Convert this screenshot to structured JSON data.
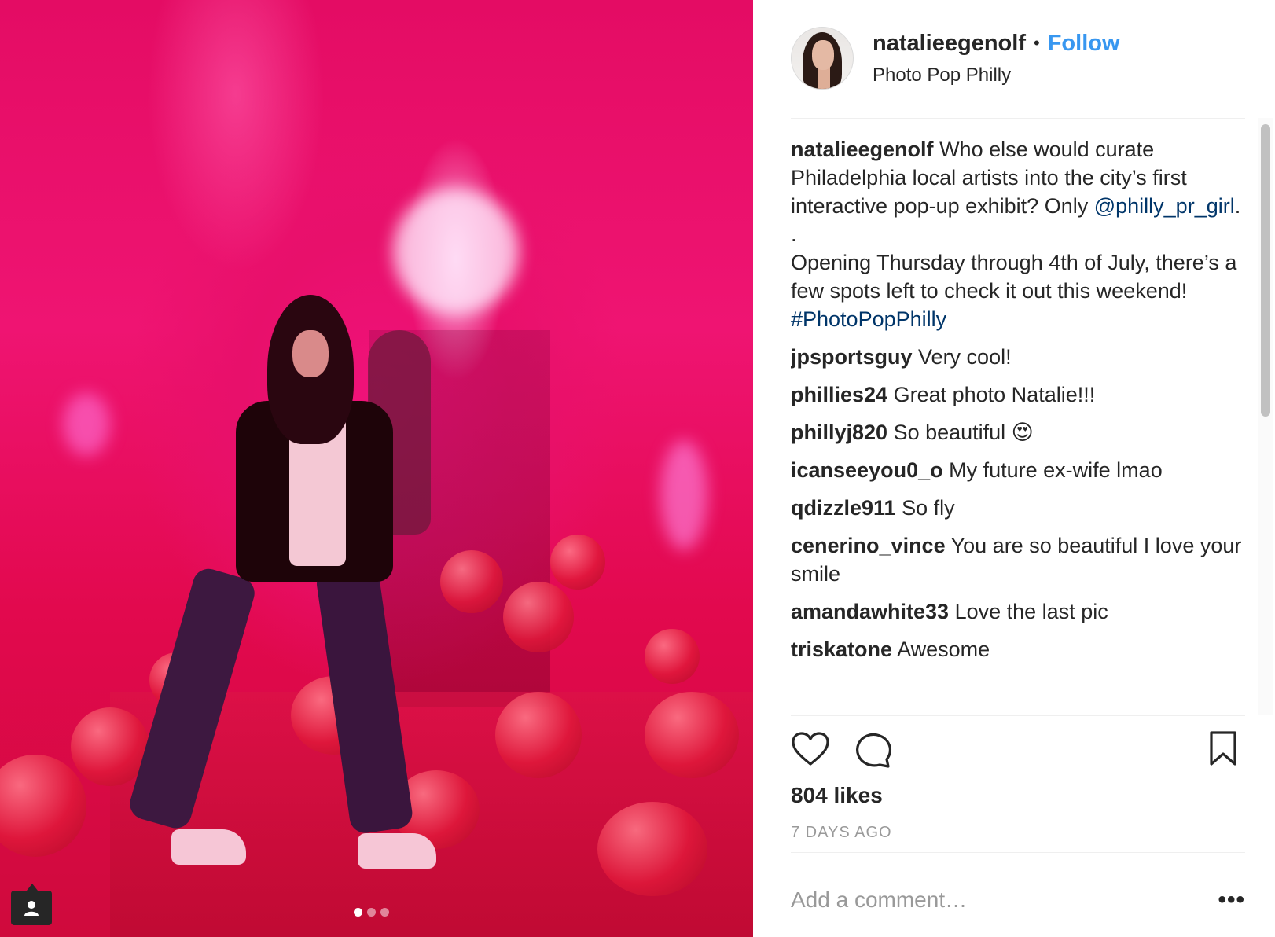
{
  "post": {
    "username": "natalieegenolf",
    "separator": "•",
    "follow_label": "Follow",
    "location": "Photo Pop Philly"
  },
  "caption": {
    "username": "natalieegenolf",
    "text_part1": "Who else would curate Philadelphia local artists into the city’s first interactive pop-up exhibit? Only",
    "mention": "@philly_pr_girl",
    "text_part2": ".",
    "dot_line": ".",
    "text_part3": "Opening Thursday through 4th of July, there’s a few spots left to check it out this weekend!",
    "hashtag": "#PhotoPopPhilly"
  },
  "comments": [
    {
      "user": "jpsportsguy",
      "text": "Very cool!"
    },
    {
      "user": "phillies24",
      "text": "Great photo Natalie!!!"
    },
    {
      "user": "phillyj820",
      "text": "So beautiful 😍"
    },
    {
      "user": "icanseeyou0_o",
      "text": "My future ex-wife lmao"
    },
    {
      "user": "qdizzle911",
      "text": "So fly"
    },
    {
      "user": "cenerino_vince",
      "text": "You are so beautiful I love your smile"
    },
    {
      "user": "amandawhite33",
      "text": "Love the last pic"
    },
    {
      "user": "triskatone",
      "text": "Awesome"
    }
  ],
  "likes": "804 likes",
  "timestamp": "7 DAYS AGO",
  "comment_box": {
    "placeholder": "Add a comment…",
    "more_label": "•••"
  },
  "carousel": {
    "count": 3,
    "active": 0
  },
  "icons": {
    "like": "heart-icon",
    "comment": "comment-bubble-icon",
    "save": "bookmark-icon",
    "tagged": "person-tag-icon"
  },
  "colors": {
    "follow": "#3897f0",
    "mention": "#003569",
    "muted": "#999999"
  }
}
